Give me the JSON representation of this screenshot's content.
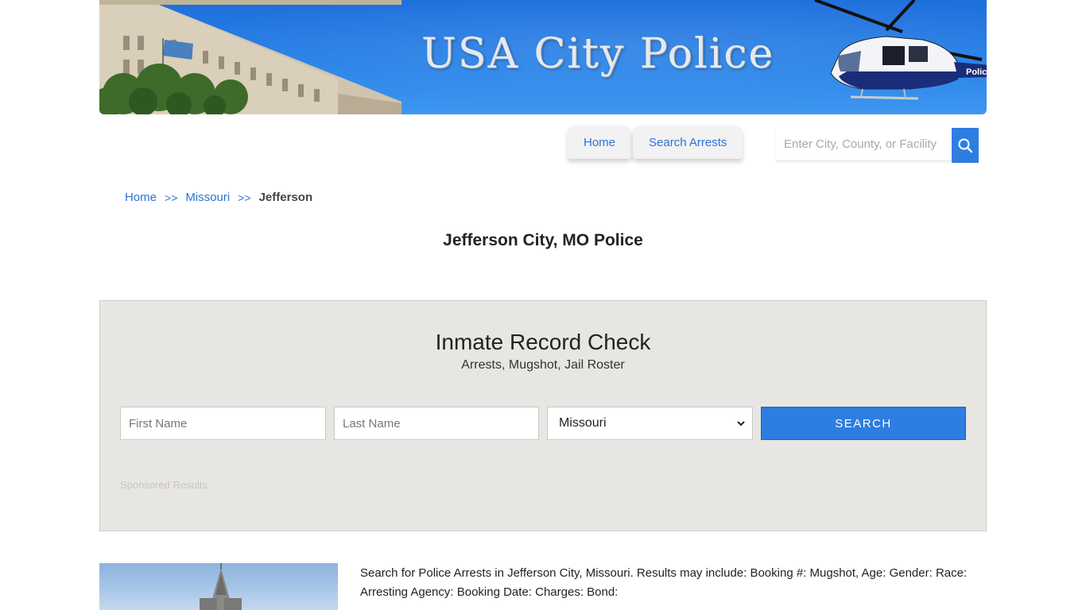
{
  "banner": {
    "title": "USA City Police",
    "heli_text": "Police"
  },
  "nav": {
    "tabs": [
      {
        "label": "Home"
      },
      {
        "label": "Search Arrests"
      }
    ]
  },
  "site_search": {
    "placeholder": "Enter City, County, or Facility"
  },
  "breadcrumb": {
    "home": "Home",
    "state": "Missouri",
    "current": "Jefferson",
    "separator": ">>"
  },
  "page_title": "Jefferson City, MO Police",
  "inmate_check": {
    "heading": "Inmate Record Check",
    "subheading": "Arrests, Mugshot, Jail Roster",
    "first_name_placeholder": "First Name",
    "last_name_placeholder": "Last Name",
    "state_selected": "Missouri",
    "search_label": "SEARCH",
    "sponsored": "Sponsored Results"
  },
  "description": "Search for Police Arrests in Jefferson City, Missouri. Results may include: Booking #: Mugshot, Age: Gender: Race: Arresting Agency: Booking Date: Charges: Bond:",
  "colors": {
    "accent": "#2e7de1",
    "link": "#2b74d8",
    "panel_bg": "#e8e6e2"
  }
}
